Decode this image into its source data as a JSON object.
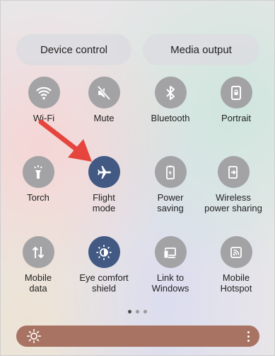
{
  "top_buttons": {
    "device_control": "Device control",
    "media_output": "Media output"
  },
  "tiles": [
    {
      "label": "Wi-Fi",
      "icon": "wifi-icon",
      "state": "off"
    },
    {
      "label": "Mute",
      "icon": "mute-icon",
      "state": "off"
    },
    {
      "label": "Bluetooth",
      "icon": "bluetooth-icon",
      "state": "off"
    },
    {
      "label": "Portrait",
      "icon": "portrait-lock-icon",
      "state": "off"
    },
    {
      "label": "Torch",
      "icon": "torch-icon",
      "state": "off"
    },
    {
      "label": "Flight\nmode",
      "icon": "airplane-icon",
      "state": "on"
    },
    {
      "label": "Power\nsaving",
      "icon": "power-saving-icon",
      "state": "off"
    },
    {
      "label": "Wireless\npower sharing",
      "icon": "wireless-power-sharing-icon",
      "state": "off"
    },
    {
      "label": "Mobile\ndata",
      "icon": "mobile-data-icon",
      "state": "off"
    },
    {
      "label": "Eye comfort\nshield",
      "icon": "eye-comfort-icon",
      "state": "on"
    },
    {
      "label": "Link to\nWindows",
      "icon": "link-to-windows-icon",
      "state": "off"
    },
    {
      "label": "Mobile\nHotspot",
      "icon": "hotspot-icon",
      "state": "off"
    }
  ],
  "pager": {
    "pages": 3,
    "current": 1
  },
  "colors": {
    "tile_off": "#a3a3a6",
    "tile_on": "#415983",
    "brightness_bar": "#a87363",
    "arrow": "#e5453c"
  }
}
